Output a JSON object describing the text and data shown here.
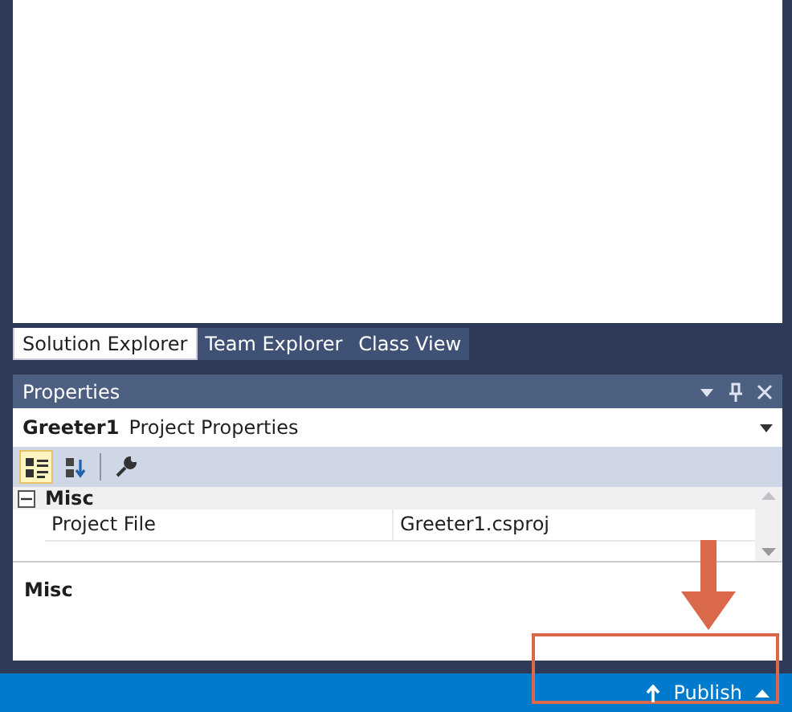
{
  "tabs": [
    {
      "label": "Solution Explorer",
      "selected": true
    },
    {
      "label": "Team Explorer",
      "selected": false
    },
    {
      "label": "Class View",
      "selected": false
    }
  ],
  "properties_panel": {
    "title": "Properties",
    "object_name": "Greeter1",
    "object_type": "Project Properties",
    "toolbar": [
      {
        "kind": "categorized",
        "selected": true
      },
      {
        "kind": "alphabetical",
        "selected": false
      },
      {
        "kind": "property-pages",
        "selected": false
      }
    ],
    "category": {
      "label": "Misc",
      "expanded": true
    },
    "rows": [
      {
        "name": "Project File",
        "value": "Greeter1.csproj"
      }
    ],
    "description_title": "Misc"
  },
  "status_bar": {
    "publish_label": "Publish"
  }
}
